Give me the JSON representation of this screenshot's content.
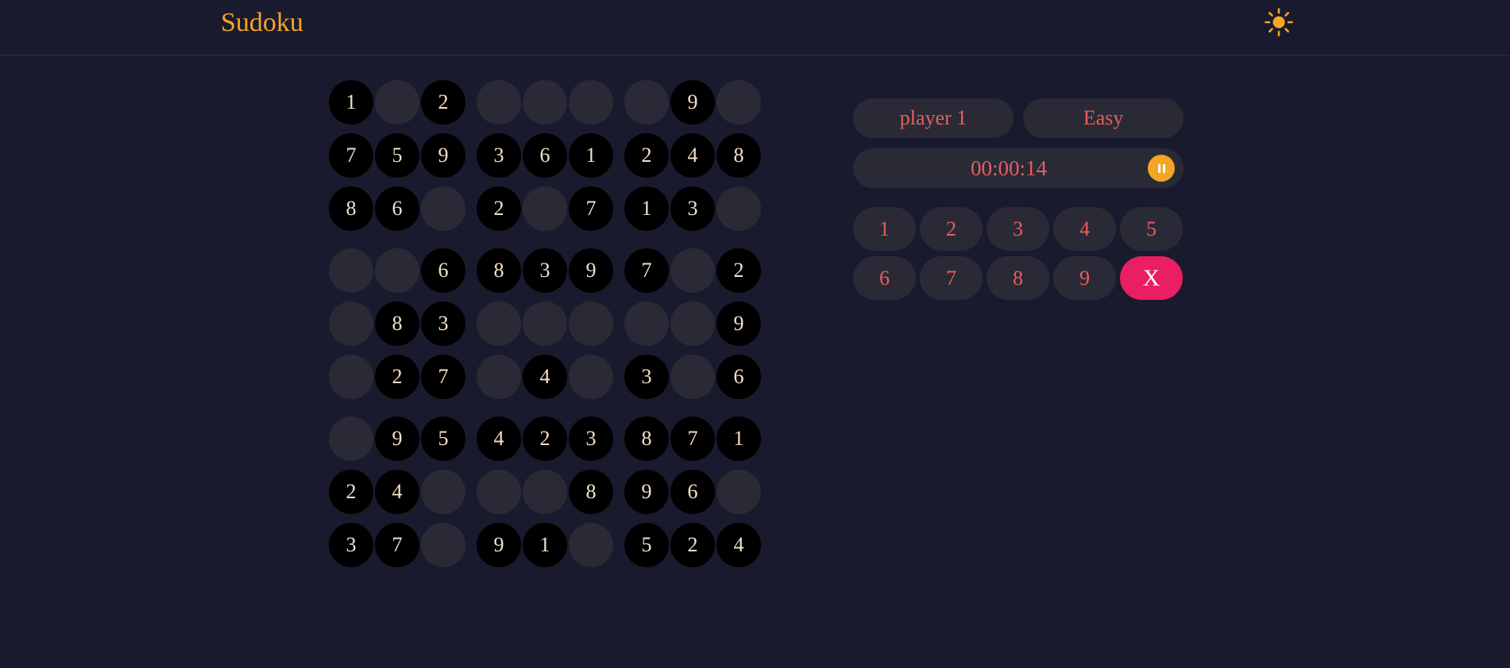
{
  "header": {
    "title": "Sudoku",
    "theme_icon": "sun-icon",
    "accent_color": "#f5a524"
  },
  "board": {
    "cells": [
      [
        "1",
        "",
        "2",
        "",
        "",
        "",
        "",
        "9",
        ""
      ],
      [
        "7",
        "5",
        "9",
        "3",
        "6",
        "1",
        "2",
        "4",
        "8"
      ],
      [
        "8",
        "6",
        "",
        "2",
        "",
        "7",
        "1",
        "3",
        ""
      ],
      [
        "",
        "",
        "6",
        "8",
        "3",
        "9",
        "7",
        "",
        "2"
      ],
      [
        "",
        "8",
        "3",
        "",
        "",
        "",
        "",
        "",
        "9"
      ],
      [
        "",
        "2",
        "7",
        "",
        "4",
        "",
        "3",
        "",
        "6"
      ],
      [
        "",
        "9",
        "5",
        "4",
        "2",
        "3",
        "8",
        "7",
        "1"
      ],
      [
        "2",
        "4",
        "",
        "",
        "",
        "8",
        "9",
        "6",
        ""
      ],
      [
        "3",
        "7",
        "",
        "9",
        "1",
        "",
        "5",
        "2",
        "4"
      ]
    ]
  },
  "panel": {
    "player_name": "player 1",
    "difficulty": "Easy",
    "timer": "00:00:14",
    "pause_icon": "pause-icon",
    "numpad": [
      "1",
      "2",
      "3",
      "4",
      "5",
      "6",
      "7",
      "8",
      "9"
    ],
    "erase_label": "X"
  },
  "colors": {
    "background": "#1a1a2e",
    "given_cell": "#000000",
    "empty_cell": "#2a2a36",
    "text_red": "#e85d5d",
    "erase_pink": "#e91e63"
  }
}
